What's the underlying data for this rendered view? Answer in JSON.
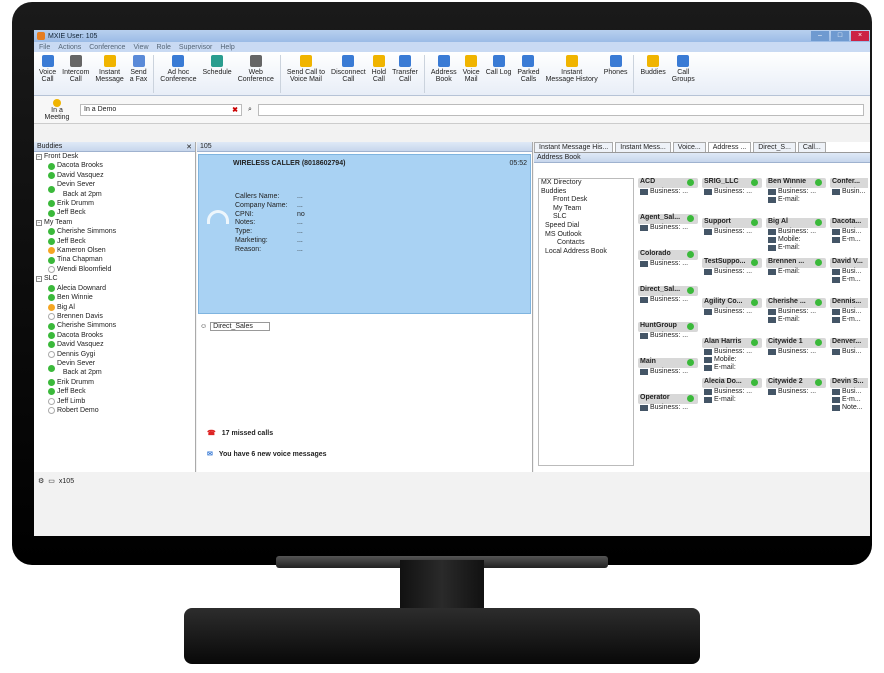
{
  "window": {
    "title": "MXIE User: 105"
  },
  "menu": [
    "File",
    "Actions",
    "Conference",
    "View",
    "Role",
    "Supervisor",
    "Help"
  ],
  "toolbar": [
    {
      "label": "Voice\nCall",
      "icon": "phone-icon",
      "color": "#3a7bd5"
    },
    {
      "label": "Intercom\nCall",
      "icon": "intercom-icon",
      "color": "#666"
    },
    {
      "label": "Instant\nMessage",
      "icon": "chat-icon",
      "color": "#f0b400"
    },
    {
      "label": "Send\na Fax",
      "icon": "fax-icon",
      "color": "#5a8ad8"
    },
    {
      "label": "Ad hoc\nConference",
      "icon": "conference-icon",
      "color": "#3a7bd5"
    },
    {
      "label": "Schedule",
      "icon": "calendar-icon",
      "color": "#2a9d8f"
    },
    {
      "label": "Web\nConference",
      "icon": "web-conference-icon",
      "color": "#666"
    },
    {
      "label": "Send Call to\nVoice Mail",
      "icon": "voicemail-icon",
      "color": "#f0b400"
    },
    {
      "label": "Disconnect\nCall",
      "icon": "disconnect-icon",
      "color": "#3a7bd5"
    },
    {
      "label": "Hold\nCall",
      "icon": "hold-icon",
      "color": "#f0b400"
    },
    {
      "label": "Transfer\nCall",
      "icon": "transfer-icon",
      "color": "#3a7bd5"
    },
    {
      "label": "Address\nBook",
      "icon": "address-book-icon",
      "color": "#3a7bd5"
    },
    {
      "label": "Voice\nMail",
      "icon": "voice-mail-icon",
      "color": "#f0b400"
    },
    {
      "label": "Call Log",
      "icon": "call-log-icon",
      "color": "#3a7bd5"
    },
    {
      "label": "Parked\nCalls",
      "icon": "parked-calls-icon",
      "color": "#3a7bd5"
    },
    {
      "label": "Instant\nMessage History",
      "icon": "message-history-icon",
      "color": "#f0b400"
    },
    {
      "label": "Phones",
      "icon": "phones-icon",
      "color": "#3a7bd5"
    },
    {
      "label": "Buddies",
      "icon": "buddies-icon",
      "color": "#f0b400"
    },
    {
      "label": "Call\nGroups",
      "icon": "call-groups-icon",
      "color": "#3a7bd5"
    }
  ],
  "status": {
    "label": "In a\nMeeting",
    "value": "In a Demo"
  },
  "buddies": {
    "title": "Buddies",
    "groups": [
      {
        "name": "Front Desk",
        "items": [
          [
            "Dacota Brooks",
            "g"
          ],
          [
            "David Vasquez",
            "g"
          ],
          [
            "Devin Sever\n   Back at 2pm",
            "g"
          ],
          [
            "Erik Drumm",
            "g"
          ],
          [
            "Jeff Beck",
            "g"
          ]
        ]
      },
      {
        "name": "My Team",
        "items": [
          [
            "Cherishe Simmons",
            "g"
          ],
          [
            "Jeff Beck",
            "g"
          ],
          [
            "Kameron Olsen",
            "o"
          ],
          [
            "Tina Chapman",
            "g"
          ],
          [
            "Wendi Bloomfield",
            "w"
          ]
        ]
      },
      {
        "name": "SLC",
        "items": [
          [
            "Alecia Downard",
            "g"
          ],
          [
            "Ben Winnie",
            "g"
          ],
          [
            "Big Al",
            "o"
          ],
          [
            "Brennen Davis",
            "w"
          ],
          [
            "Cherishe Simmons",
            "g"
          ],
          [
            "Dacota Brooks",
            "g"
          ],
          [
            "David Vasquez",
            "g"
          ],
          [
            "Dennis Gygi",
            "w"
          ],
          [
            "Devin Sever\n   Back at 2pm",
            "g"
          ],
          [
            "Erik Drumm",
            "g"
          ],
          [
            "Jeff Beck",
            "g"
          ],
          [
            "Jeff Limb",
            "w"
          ],
          [
            "Robert Demo",
            "w"
          ]
        ]
      }
    ]
  },
  "call": {
    "ext": "105",
    "caller": "WIRELESS CALLER (8018602794)",
    "time": "05:52",
    "info": [
      [
        "Callers Name:",
        "..."
      ],
      [
        "Company Name:",
        "..."
      ],
      [
        "CPNI:",
        "no"
      ],
      [
        "Notes:",
        "..."
      ],
      [
        "Type:",
        "..."
      ],
      [
        "Marketing:",
        "..."
      ],
      [
        "Reason:",
        "..."
      ]
    ],
    "queue": "Direct_Sales",
    "missed": "17 missed calls",
    "voicemail": "You have 6 new voice messages"
  },
  "addressbook": {
    "tabs": [
      "Instant Message His...",
      "Instant Mess...",
      "Voice...",
      "Address ...",
      "Direct_S...",
      "Call..."
    ],
    "title": "Address Book",
    "tree": [
      "MX Directory",
      "Buddies",
      "Front Desk",
      "My Team",
      "SLC",
      "Speed Dial",
      "MS Outlook",
      "Contacts",
      "Local Address Book"
    ],
    "cards": [
      {
        "name": "ACD",
        "lines": [
          "Business: ..."
        ]
      },
      {
        "name": "Agent_Sal...",
        "lines": [
          "Business: ..."
        ]
      },
      {
        "name": "Colorado",
        "lines": [
          "Business: ..."
        ]
      },
      {
        "name": "Direct_Sal...",
        "lines": [
          "Business: ..."
        ]
      },
      {
        "name": "HuntGroup",
        "lines": [
          "Business: ..."
        ]
      },
      {
        "name": "Main",
        "lines": [
          "Business: ..."
        ]
      },
      {
        "name": "Operator",
        "lines": [
          "Business: ..."
        ]
      },
      {
        "name": "SRIG_LLC",
        "lines": [
          "Business: ..."
        ]
      },
      {
        "name": "Support",
        "lines": [
          "Business: ..."
        ]
      },
      {
        "name": "TestSuppo...",
        "lines": [
          "Business: ..."
        ]
      },
      {
        "name": "Agility Co...",
        "lines": [
          "Business: ..."
        ]
      },
      {
        "name": "Alan Harris",
        "lines": [
          "Business: ...",
          "Mobile:",
          "E-mail:"
        ]
      },
      {
        "name": "Alecia Do...",
        "lines": [
          "Business: ...",
          "E-mail:"
        ]
      },
      {
        "name": "Ben Winnie",
        "lines": [
          "Business: ...",
          "E-mail:"
        ]
      },
      {
        "name": "Big Al",
        "lines": [
          "Business: ...",
          "Mobile:",
          "E-mail:"
        ]
      },
      {
        "name": "Brennen ...",
        "lines": [
          "E-mail:"
        ]
      },
      {
        "name": "Cherishe ...",
        "lines": [
          "Business: ...",
          "E-mail:"
        ]
      },
      {
        "name": "Citywide 1",
        "lines": [
          "Business: ..."
        ]
      },
      {
        "name": "Citywide 2",
        "lines": [
          "Business: ..."
        ]
      },
      {
        "name": "Confer...",
        "lines": [
          "Busin..."
        ]
      },
      {
        "name": "Dacota...",
        "lines": [
          "Busi...",
          "E-m..."
        ]
      },
      {
        "name": "David V...",
        "lines": [
          "Busi...",
          "E-m..."
        ]
      },
      {
        "name": "Dennis...",
        "lines": [
          "Busi...",
          "E-m..."
        ]
      },
      {
        "name": "Denver...",
        "lines": [
          "Busi..."
        ]
      },
      {
        "name": "Devin S...",
        "lines": [
          "Busi...",
          "E-m...",
          "Note..."
        ]
      }
    ]
  },
  "statusbar": {
    "ext": "x105"
  }
}
